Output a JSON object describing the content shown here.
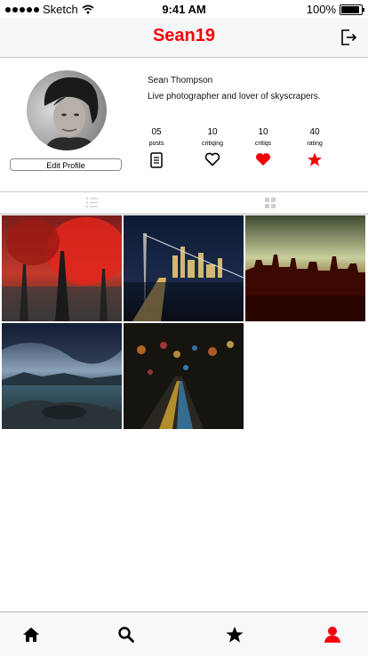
{
  "status_bar": {
    "carrier": "Sketch",
    "time": "9:41 AM",
    "battery": "100%",
    "battery_level": 1.0
  },
  "nav": {
    "title": "Sean19",
    "logout_icon": "logout-icon",
    "accent": "#f5000a"
  },
  "profile": {
    "name": "Sean Thompson",
    "bio": "Live photographer and lover of skyscrapers.",
    "edit_label": "Edit Profile",
    "stats": [
      {
        "value": "05",
        "label": "posts",
        "icon": "document-icon"
      },
      {
        "value": "10",
        "label": "critiqing",
        "icon": "heart-outline-icon"
      },
      {
        "value": "10",
        "label": "critiqs",
        "icon": "heart-filled-icon"
      },
      {
        "value": "40",
        "label": "rating",
        "icon": "star-icon"
      }
    ]
  },
  "view_toggle": {
    "list_icon": "list-view-icon",
    "grid_icon": "grid-view-icon"
  },
  "photos": [
    {
      "subject": "red-forest-photo"
    },
    {
      "subject": "bridge-night-city-photo"
    },
    {
      "subject": "city-skyline-sunset-photo"
    },
    {
      "subject": "lake-mountains-storm-photo"
    },
    {
      "subject": "rainy-street-bokeh-photo"
    }
  ],
  "tab_bar": {
    "items": [
      {
        "icon": "home-icon",
        "active": false
      },
      {
        "icon": "search-icon",
        "active": false
      },
      {
        "icon": "star-icon",
        "active": false
      },
      {
        "icon": "profile-icon",
        "active": true
      }
    ],
    "active_color": "#f5000a"
  }
}
